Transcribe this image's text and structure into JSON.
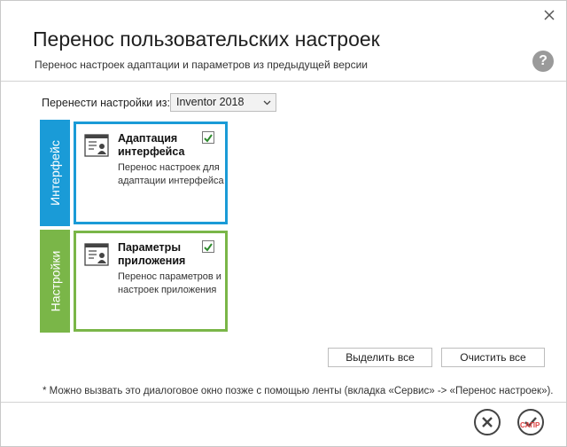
{
  "dialog": {
    "title": "Перенос пользовательских настроек",
    "subtitle": "Перенос настроек адаптации и параметров из предыдущей версии",
    "close_icon": "close-icon",
    "help_icon": "help-icon",
    "help_glyph": "?"
  },
  "source": {
    "label": "Перенести настройки из:",
    "selected": "Inventor 2018"
  },
  "tabs": [
    {
      "label": "Интерфейс",
      "color": "#1a9bd7"
    },
    {
      "label": "Настройки",
      "color": "#7ab648"
    }
  ],
  "cards": [
    {
      "title_line1": "Адаптация",
      "title_line2": "интерфейса",
      "desc_line1": "Перенос настроек для",
      "desc_line2": "адаптации интерфейса",
      "checked": true
    },
    {
      "title_line1": "Параметры",
      "title_line2": "приложения",
      "desc_line1": "Перенос параметров и",
      "desc_line2": "настроек приложения",
      "checked": true
    }
  ],
  "buttons": {
    "select_all": "Выделить все",
    "clear_all": "Очистить все"
  },
  "footnote": "* Можно вызвать это диалоговое окно позже с помощью ленты (вкладка «Сервис» -> «Перенос настроек»).",
  "watermark": "САПР"
}
